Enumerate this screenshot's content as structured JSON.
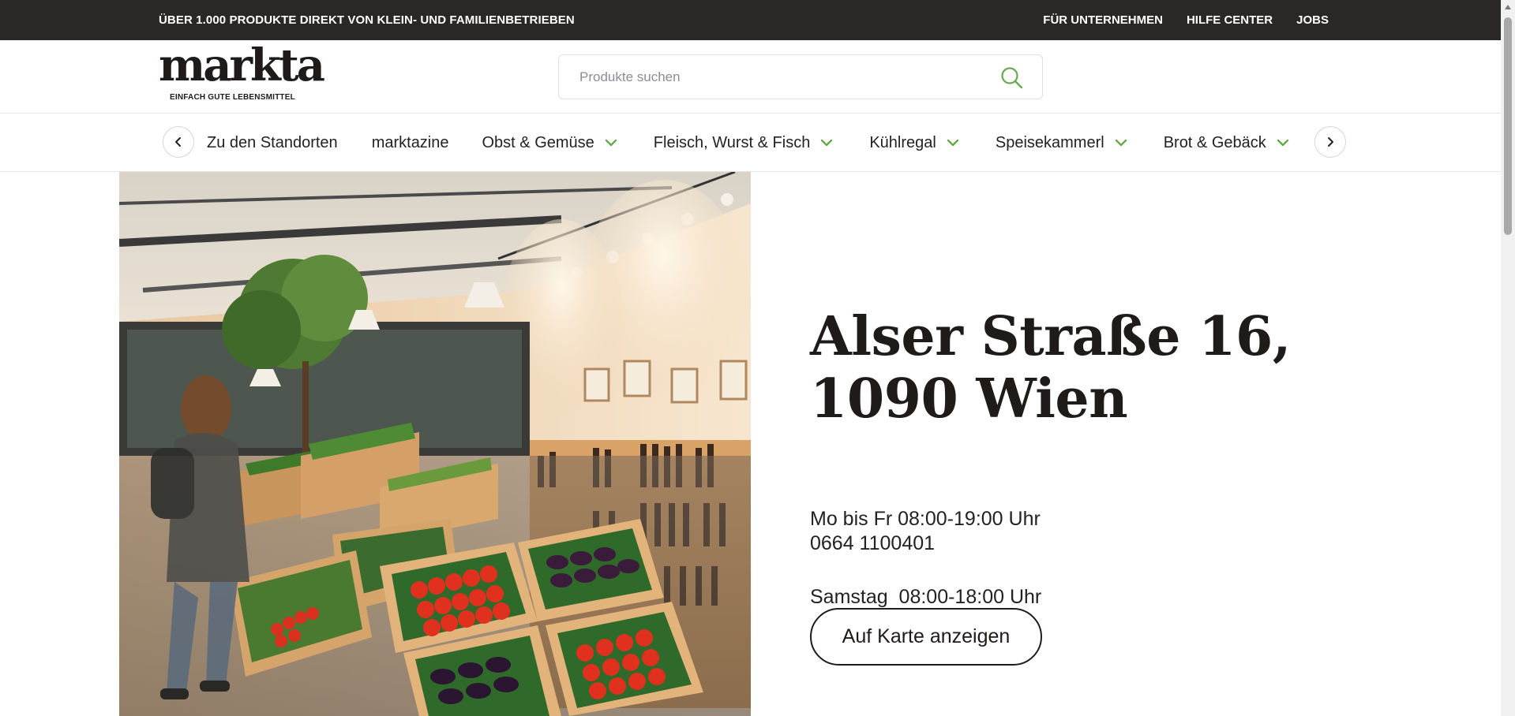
{
  "topbar": {
    "promo": "ÜBER 1.000 PRODUKTE DIREKT VON KLEIN- UND FAMILIENBETRIEBEN",
    "links": [
      "FÜR UNTERNEHMEN",
      "HILFE CENTER",
      "JOBS"
    ]
  },
  "header": {
    "logo_wordmark": "markta",
    "logo_tagline": "EINFACH GUTE LEBENSMITTEL",
    "search_placeholder": "Produkte suchen",
    "search_value": ""
  },
  "nav": {
    "items": [
      {
        "label": "Zu den Standorten",
        "has_dropdown": false
      },
      {
        "label": "marktazine",
        "has_dropdown": false
      },
      {
        "label": "Obst & Gemüse",
        "has_dropdown": true
      },
      {
        "label": "Fleisch, Wurst & Fisch",
        "has_dropdown": true
      },
      {
        "label": "Kühlregal",
        "has_dropdown": true
      },
      {
        "label": "Speisekammerl",
        "has_dropdown": true
      },
      {
        "label": "Brot & Gebäck",
        "has_dropdown": true
      }
    ],
    "icons": {
      "prev": "chevron-left-icon",
      "next": "chevron-right-icon",
      "dropdown": "chevron-down-icon"
    }
  },
  "store": {
    "address_line1": "Alser Straße 16,",
    "address_line2": "1090 Wien",
    "hours_line1": "Mo bis Fr 08:00-19:00 Uhr",
    "hours_line2": "Samstag  08:00-18:00 Uhr",
    "phone": "0664 1100401",
    "map_button": "Auf Karte anzeigen"
  },
  "colors": {
    "topbar_bg": "#2a2726",
    "accent_green": "#6aa84f",
    "text_dark": "#1e1b1a"
  }
}
